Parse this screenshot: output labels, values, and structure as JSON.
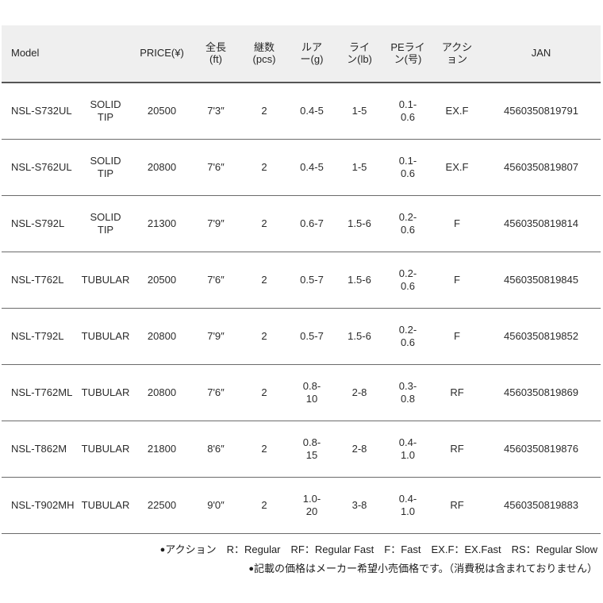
{
  "table": {
    "headers": [
      {
        "main": "Model",
        "sub": ""
      },
      {
        "main": "",
        "sub": ""
      },
      {
        "main": "PRICE(¥)",
        "sub": ""
      },
      {
        "main": "全長",
        "sub": "(ft)"
      },
      {
        "main": "継数",
        "sub": "(pcs)"
      },
      {
        "main": "ルア",
        "sub": "ー(g)"
      },
      {
        "main": "ライ",
        "sub": "ン(lb)"
      },
      {
        "main": "PEライ",
        "sub": "ン(号)"
      },
      {
        "main": "アクシ",
        "sub": "ョン"
      },
      {
        "main": "JAN",
        "sub": ""
      }
    ],
    "rows": [
      {
        "model": "NSL-S732UL",
        "tip_type": "SOLID\nTIP",
        "price": "20500",
        "length": "7'3″",
        "pieces": "2",
        "lure": "0.4-5",
        "line": "1-5",
        "pe_line": "0.1-\n0.6",
        "action": "EX.F",
        "jan": "4560350819791"
      },
      {
        "model": "NSL-S762UL",
        "tip_type": "SOLID\nTIP",
        "price": "20800",
        "length": "7'6″",
        "pieces": "2",
        "lure": "0.4-5",
        "line": "1-5",
        "pe_line": "0.1-\n0.6",
        "action": "EX.F",
        "jan": "4560350819807"
      },
      {
        "model": "NSL-S792L",
        "tip_type": "SOLID\nTIP",
        "price": "21300",
        "length": "7'9″",
        "pieces": "2",
        "lure": "0.6-7",
        "line": "1.5-6",
        "pe_line": "0.2-\n0.6",
        "action": "F",
        "jan": "4560350819814"
      },
      {
        "model": "NSL-T762L",
        "tip_type": "TUBULAR",
        "price": "20500",
        "length": "7'6″",
        "pieces": "2",
        "lure": "0.5-7",
        "line": "1.5-6",
        "pe_line": "0.2-\n0.6",
        "action": "F",
        "jan": "4560350819845"
      },
      {
        "model": "NSL-T792L",
        "tip_type": "TUBULAR",
        "price": "20800",
        "length": "7'9″",
        "pieces": "2",
        "lure": "0.5-7",
        "line": "1.5-6",
        "pe_line": "0.2-\n0.6",
        "action": "F",
        "jan": "4560350819852"
      },
      {
        "model": "NSL-T762ML",
        "tip_type": "TUBULAR",
        "price": "20800",
        "length": "7'6″",
        "pieces": "2",
        "lure": "0.8-\n10",
        "line": "2-8",
        "pe_line": "0.3-\n0.8",
        "action": "RF",
        "jan": "4560350819869"
      },
      {
        "model": "NSL-T862M",
        "tip_type": "TUBULAR",
        "price": "21800",
        "length": "8'6″",
        "pieces": "2",
        "lure": "0.8-\n15",
        "line": "2-8",
        "pe_line": "0.4-\n1.0",
        "action": "RF",
        "jan": "4560350819876"
      },
      {
        "model": "NSL-T902MH",
        "tip_type": "TUBULAR",
        "price": "22500",
        "length": "9'0″",
        "pieces": "2",
        "lure": "1.0-\n20",
        "line": "3-8",
        "pe_line": "0.4-\n1.0",
        "action": "RF",
        "jan": "4560350819883"
      }
    ]
  },
  "notes": {
    "action_legend": "アクション　R：Regular　RF：Regular Fast　F：Fast　EX.F：EX.Fast　RS：Regular Slow",
    "price_note": "記載の価格はメーカー希望小売価格です。（消費税は含まれておりません）",
    "bullet": "●"
  },
  "colors": {
    "header_bg": "#efefef",
    "header_border": "#555555",
    "row_border": "#6b6b6b",
    "text": "#2b2b2b",
    "page_bg": "#ffffff"
  }
}
